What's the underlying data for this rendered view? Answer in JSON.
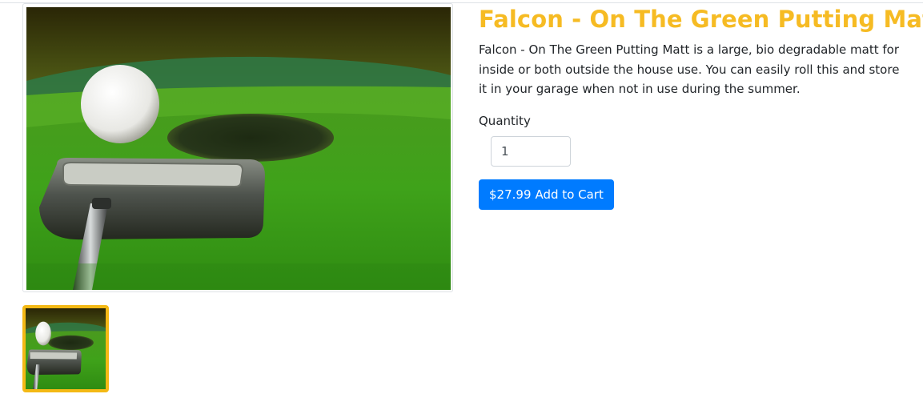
{
  "product": {
    "title": "Falcon - On The Green Putting Matt",
    "description": "Falcon - On The Green Putting Matt is a large, bio degradable matt for inside or both outside the house use. You can easily roll this and store it in your garage when not in use during the summer.",
    "quantity_label": "Quantity",
    "quantity_value": "1",
    "price": "$27.99",
    "add_to_cart_label": "Add to Cart"
  },
  "colors": {
    "title": "#f6bb23",
    "button": "#007bff",
    "thumbnail_border": "#f4b915"
  },
  "images": {
    "main": "golf-ball-putter-hole-photo",
    "thumbnails": [
      "golf-ball-putter-hole-photo"
    ]
  }
}
